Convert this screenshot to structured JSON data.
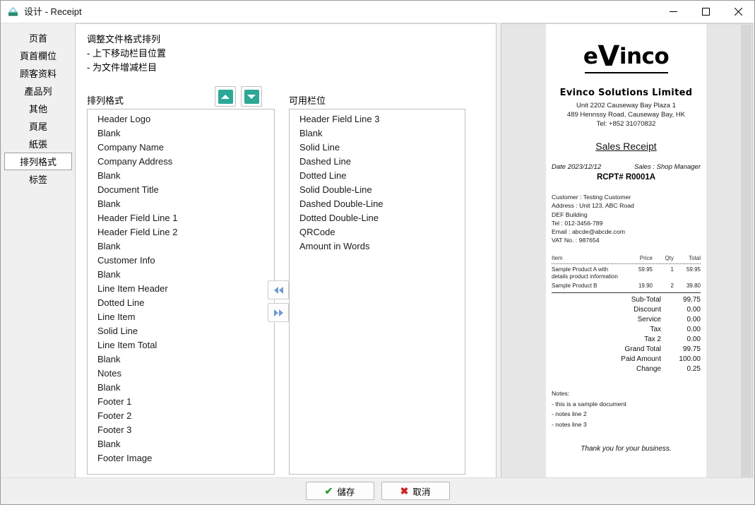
{
  "window": {
    "title": "设计 - Receipt",
    "icon": "app-icon",
    "minimize": "—",
    "maximize": "□",
    "close": "✕"
  },
  "sidebar": {
    "items": [
      {
        "label": "页首",
        "selected": false
      },
      {
        "label": "頁首欄位",
        "selected": false
      },
      {
        "label": "顾客资料",
        "selected": false
      },
      {
        "label": "產品列",
        "selected": false
      },
      {
        "label": "其他",
        "selected": false
      },
      {
        "label": "頁尾",
        "selected": false
      },
      {
        "label": "紙張",
        "selected": false
      },
      {
        "label": "排列格式",
        "selected": true
      },
      {
        "label": "标签",
        "selected": false
      }
    ]
  },
  "main": {
    "instructions": [
      "调整文件格式排列",
      "- 上下移动栏目位置",
      "- 为文件增减栏目"
    ],
    "arranged_label": "排列格式",
    "available_label": "可用栏位",
    "order_buttons": [
      {
        "name": "move-up-button",
        "icon": "triangle-up-icon"
      },
      {
        "name": "move-down-button",
        "icon": "triangle-down-icon"
      }
    ],
    "transfer_buttons": [
      {
        "name": "move-left-button",
        "icon": "double-arrow-left-icon"
      },
      {
        "name": "move-right-button",
        "icon": "double-arrow-right-icon"
      }
    ],
    "arranged_items": [
      "Header Logo",
      "Blank",
      "Company Name",
      "Company Address",
      "Blank",
      "Document Title",
      "Blank",
      "Header Field Line 1",
      "Header Field Line 2",
      "Blank",
      "Customer Info",
      "Blank",
      "Line Item Header",
      "Dotted Line",
      "Line Item",
      "Solid Line",
      "Line Item Total",
      "Blank",
      "Notes",
      "Blank",
      "Footer 1",
      "Footer 2",
      "Footer 3",
      "Blank",
      "Footer Image"
    ],
    "available_items": [
      "Header Field Line 3",
      "Blank",
      "Solid Line",
      "Dashed Line",
      "Dotted Line",
      "Solid Double-Line",
      "Dashed Double-Line",
      "Dotted Double-Line",
      "QRCode",
      "Amount in Words"
    ]
  },
  "preview": {
    "logo_text_1": "e",
    "logo_text_v": "V",
    "logo_text_2": "inco",
    "company_name": "Evinco Solutions Limited",
    "address_line_1": "Unit 2202 Causeway Bay Plaza 1",
    "address_line_2": "489 Hennssy Road, Causeway Bay, HK",
    "address_line_3": "Tel: +852 31070832",
    "doc_title": "Sales Receipt",
    "date": "Date 2023/12/12",
    "sales": "Sales : Shop Manager",
    "receipt_no": "RCPT# R0001A",
    "customer_lines": [
      "Customer : Testing Customer",
      "Address : Unit 123, ABC Road",
      "DEF Building",
      "Tel : 012-3456-789",
      "Email : abcde@abcde.com",
      "VAT No. : 987654"
    ],
    "table_headers": {
      "item": "Item",
      "price": "Price",
      "qty": "Qty",
      "total": "Total"
    },
    "line_items": [
      {
        "name": "Sample Product A with",
        "name2": "details product information",
        "price": "59.95",
        "qty": "1",
        "total": "59.95"
      },
      {
        "name": "Sample Product B",
        "name2": "",
        "price": "19.90",
        "qty": "2",
        "total": "39.80"
      }
    ],
    "totals": [
      {
        "label": "Sub-Total",
        "value": "99.75"
      },
      {
        "label": "Discount",
        "value": "0.00"
      },
      {
        "label": "Service",
        "value": "0.00"
      },
      {
        "label": "Tax",
        "value": "0.00"
      },
      {
        "label": "Tax 2",
        "value": "0.00"
      },
      {
        "label": "Grand Total",
        "value": "99.75"
      },
      {
        "label": "Paid Amount",
        "value": "100.00"
      },
      {
        "label": "Change",
        "value": "0.25"
      }
    ],
    "notes_title": "Notes:",
    "notes": [
      "- this is a sample document",
      "- notes line 2",
      "- notes line 3"
    ],
    "thank_you": "Thank you for your business."
  },
  "footer": {
    "save_label": "儲存",
    "cancel_label": "取消",
    "save_icon": "✔",
    "cancel_icon": "✖"
  },
  "colors": {
    "accent_teal": "#2ba896",
    "accent_blue": "#6b9bd2",
    "save_green": "#2e9b2e",
    "cancel_red": "#cc2222"
  }
}
